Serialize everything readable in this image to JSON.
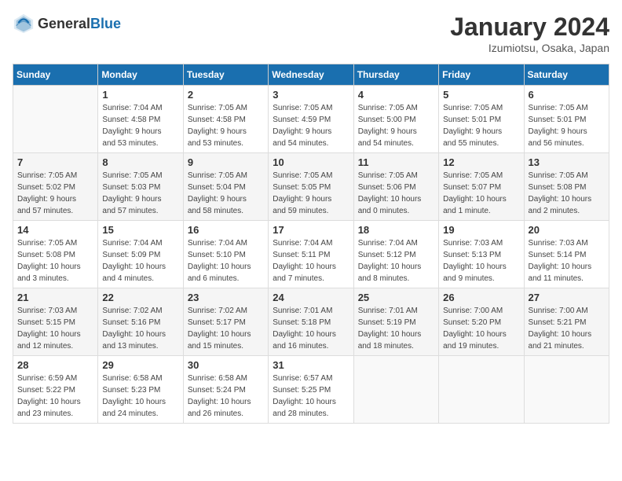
{
  "header": {
    "logo_general": "General",
    "logo_blue": "Blue",
    "month_title": "January 2024",
    "location": "Izumiotsu, Osaka, Japan"
  },
  "days_of_week": [
    "Sunday",
    "Monday",
    "Tuesday",
    "Wednesday",
    "Thursday",
    "Friday",
    "Saturday"
  ],
  "weeks": [
    [
      {
        "day": "",
        "info": ""
      },
      {
        "day": "1",
        "info": "Sunrise: 7:04 AM\nSunset: 4:58 PM\nDaylight: 9 hours\nand 53 minutes."
      },
      {
        "day": "2",
        "info": "Sunrise: 7:05 AM\nSunset: 4:58 PM\nDaylight: 9 hours\nand 53 minutes."
      },
      {
        "day": "3",
        "info": "Sunrise: 7:05 AM\nSunset: 4:59 PM\nDaylight: 9 hours\nand 54 minutes."
      },
      {
        "day": "4",
        "info": "Sunrise: 7:05 AM\nSunset: 5:00 PM\nDaylight: 9 hours\nand 54 minutes."
      },
      {
        "day": "5",
        "info": "Sunrise: 7:05 AM\nSunset: 5:01 PM\nDaylight: 9 hours\nand 55 minutes."
      },
      {
        "day": "6",
        "info": "Sunrise: 7:05 AM\nSunset: 5:01 PM\nDaylight: 9 hours\nand 56 minutes."
      }
    ],
    [
      {
        "day": "7",
        "info": "Sunrise: 7:05 AM\nSunset: 5:02 PM\nDaylight: 9 hours\nand 57 minutes."
      },
      {
        "day": "8",
        "info": "Sunrise: 7:05 AM\nSunset: 5:03 PM\nDaylight: 9 hours\nand 57 minutes."
      },
      {
        "day": "9",
        "info": "Sunrise: 7:05 AM\nSunset: 5:04 PM\nDaylight: 9 hours\nand 58 minutes."
      },
      {
        "day": "10",
        "info": "Sunrise: 7:05 AM\nSunset: 5:05 PM\nDaylight: 9 hours\nand 59 minutes."
      },
      {
        "day": "11",
        "info": "Sunrise: 7:05 AM\nSunset: 5:06 PM\nDaylight: 10 hours\nand 0 minutes."
      },
      {
        "day": "12",
        "info": "Sunrise: 7:05 AM\nSunset: 5:07 PM\nDaylight: 10 hours\nand 1 minute."
      },
      {
        "day": "13",
        "info": "Sunrise: 7:05 AM\nSunset: 5:08 PM\nDaylight: 10 hours\nand 2 minutes."
      }
    ],
    [
      {
        "day": "14",
        "info": "Sunrise: 7:05 AM\nSunset: 5:08 PM\nDaylight: 10 hours\nand 3 minutes."
      },
      {
        "day": "15",
        "info": "Sunrise: 7:04 AM\nSunset: 5:09 PM\nDaylight: 10 hours\nand 4 minutes."
      },
      {
        "day": "16",
        "info": "Sunrise: 7:04 AM\nSunset: 5:10 PM\nDaylight: 10 hours\nand 6 minutes."
      },
      {
        "day": "17",
        "info": "Sunrise: 7:04 AM\nSunset: 5:11 PM\nDaylight: 10 hours\nand 7 minutes."
      },
      {
        "day": "18",
        "info": "Sunrise: 7:04 AM\nSunset: 5:12 PM\nDaylight: 10 hours\nand 8 minutes."
      },
      {
        "day": "19",
        "info": "Sunrise: 7:03 AM\nSunset: 5:13 PM\nDaylight: 10 hours\nand 9 minutes."
      },
      {
        "day": "20",
        "info": "Sunrise: 7:03 AM\nSunset: 5:14 PM\nDaylight: 10 hours\nand 11 minutes."
      }
    ],
    [
      {
        "day": "21",
        "info": "Sunrise: 7:03 AM\nSunset: 5:15 PM\nDaylight: 10 hours\nand 12 minutes."
      },
      {
        "day": "22",
        "info": "Sunrise: 7:02 AM\nSunset: 5:16 PM\nDaylight: 10 hours\nand 13 minutes."
      },
      {
        "day": "23",
        "info": "Sunrise: 7:02 AM\nSunset: 5:17 PM\nDaylight: 10 hours\nand 15 minutes."
      },
      {
        "day": "24",
        "info": "Sunrise: 7:01 AM\nSunset: 5:18 PM\nDaylight: 10 hours\nand 16 minutes."
      },
      {
        "day": "25",
        "info": "Sunrise: 7:01 AM\nSunset: 5:19 PM\nDaylight: 10 hours\nand 18 minutes."
      },
      {
        "day": "26",
        "info": "Sunrise: 7:00 AM\nSunset: 5:20 PM\nDaylight: 10 hours\nand 19 minutes."
      },
      {
        "day": "27",
        "info": "Sunrise: 7:00 AM\nSunset: 5:21 PM\nDaylight: 10 hours\nand 21 minutes."
      }
    ],
    [
      {
        "day": "28",
        "info": "Sunrise: 6:59 AM\nSunset: 5:22 PM\nDaylight: 10 hours\nand 23 minutes."
      },
      {
        "day": "29",
        "info": "Sunrise: 6:58 AM\nSunset: 5:23 PM\nDaylight: 10 hours\nand 24 minutes."
      },
      {
        "day": "30",
        "info": "Sunrise: 6:58 AM\nSunset: 5:24 PM\nDaylight: 10 hours\nand 26 minutes."
      },
      {
        "day": "31",
        "info": "Sunrise: 6:57 AM\nSunset: 5:25 PM\nDaylight: 10 hours\nand 28 minutes."
      },
      {
        "day": "",
        "info": ""
      },
      {
        "day": "",
        "info": ""
      },
      {
        "day": "",
        "info": ""
      }
    ]
  ]
}
